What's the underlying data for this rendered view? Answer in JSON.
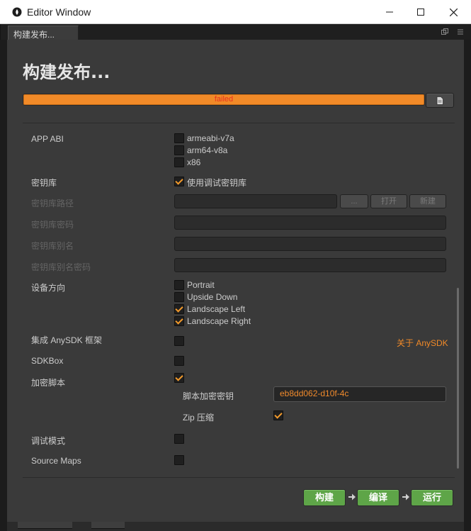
{
  "window": {
    "title": "Editor Window"
  },
  "tab": {
    "label": "构建发布..."
  },
  "panel": {
    "heading": "构建发布...",
    "progress": {
      "status_text": "failed",
      "fraction": 1.0,
      "color": "#f18a28"
    }
  },
  "form": {
    "app_abi": {
      "label": "APP ABI",
      "options": [
        {
          "label": "armeabi-v7a",
          "checked": false
        },
        {
          "label": "arm64-v8a",
          "checked": false
        },
        {
          "label": "x86",
          "checked": false
        }
      ]
    },
    "keystore": {
      "label": "密钥库",
      "use_debug_label": "使用调试密钥库",
      "use_debug_checked": true
    },
    "keystore_path": {
      "label": "密钥库路径",
      "value": "",
      "browse_label": "...",
      "open_label": "打开",
      "new_label": "新建"
    },
    "keystore_password": {
      "label": "密钥库密码",
      "value": ""
    },
    "keystore_alias": {
      "label": "密钥库别名",
      "value": ""
    },
    "keystore_alias_password": {
      "label": "密钥库别名密码",
      "value": ""
    },
    "orientation": {
      "label": "设备方向",
      "options": [
        {
          "label": "Portrait",
          "checked": false
        },
        {
          "label": "Upside Down",
          "checked": false
        },
        {
          "label": "Landscape Left",
          "checked": true
        },
        {
          "label": "Landscape Right",
          "checked": true
        }
      ]
    },
    "anysdk": {
      "label": "集成 AnySDK 框架",
      "checked": false,
      "about_link": "关于 AnySDK"
    },
    "sdkbox": {
      "label": "SDKBox",
      "checked": false
    },
    "encrypt_script": {
      "label": "加密脚本",
      "checked": true,
      "key_label": "脚本加密密钥",
      "key_value": "eb8dd062-d10f-4c",
      "zip_label": "Zip 压缩",
      "zip_checked": true
    },
    "debug_mode": {
      "label": "调试模式",
      "checked": false
    },
    "source_maps": {
      "label": "Source Maps",
      "checked": false
    }
  },
  "actions": {
    "build_label": "构建",
    "compile_label": "编译",
    "run_label": "运行",
    "button_color": "#5ea548"
  },
  "colors": {
    "accent": "#f18a28",
    "panel_bg": "#3a3a3a",
    "error_text": "#e8321f"
  }
}
